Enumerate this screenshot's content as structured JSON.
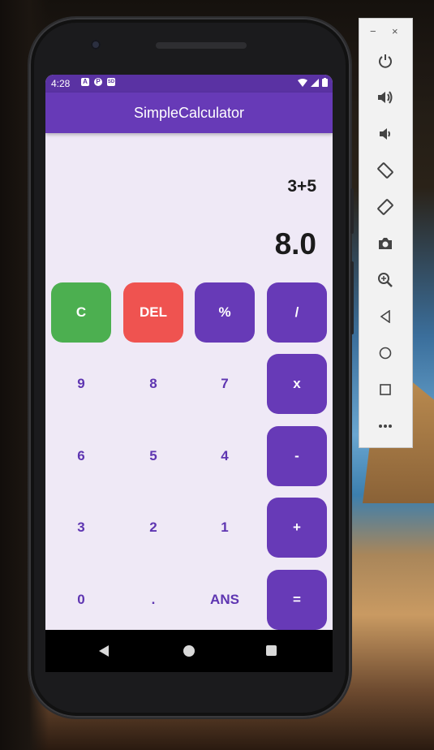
{
  "statusbar": {
    "time": "4:28",
    "left_icons": [
      "A",
      "P",
      "SD"
    ]
  },
  "app": {
    "title": "SimpleCalculator"
  },
  "display": {
    "expression": "3+5",
    "result": "8.0"
  },
  "keys": {
    "clear": "C",
    "delete": "DEL",
    "percent": "%",
    "divide": "/",
    "nine": "9",
    "eight": "8",
    "seven": "7",
    "multiply": "x",
    "six": "6",
    "five": "5",
    "four": "4",
    "minus": "-",
    "three": "3",
    "two": "2",
    "one": "1",
    "plus": "+",
    "zero": "0",
    "dot": ".",
    "ans": "ANS",
    "equals": "="
  },
  "colors": {
    "primary": "#673ab7",
    "status_bar": "#5a32a3",
    "clear_key": "#4caf50",
    "delete_key": "#ef5350",
    "digit_text": "#5e35b1",
    "screen_bg": "#efe9f6"
  },
  "emulator_toolbar": {
    "window_controls": [
      "−",
      "×"
    ],
    "tools": [
      "power-icon",
      "volume-up-icon",
      "volume-down-icon",
      "rotate-left-icon",
      "rotate-right-icon",
      "camera-icon",
      "zoom-icon",
      "back-icon",
      "home-icon",
      "overview-icon",
      "more-icon"
    ]
  }
}
